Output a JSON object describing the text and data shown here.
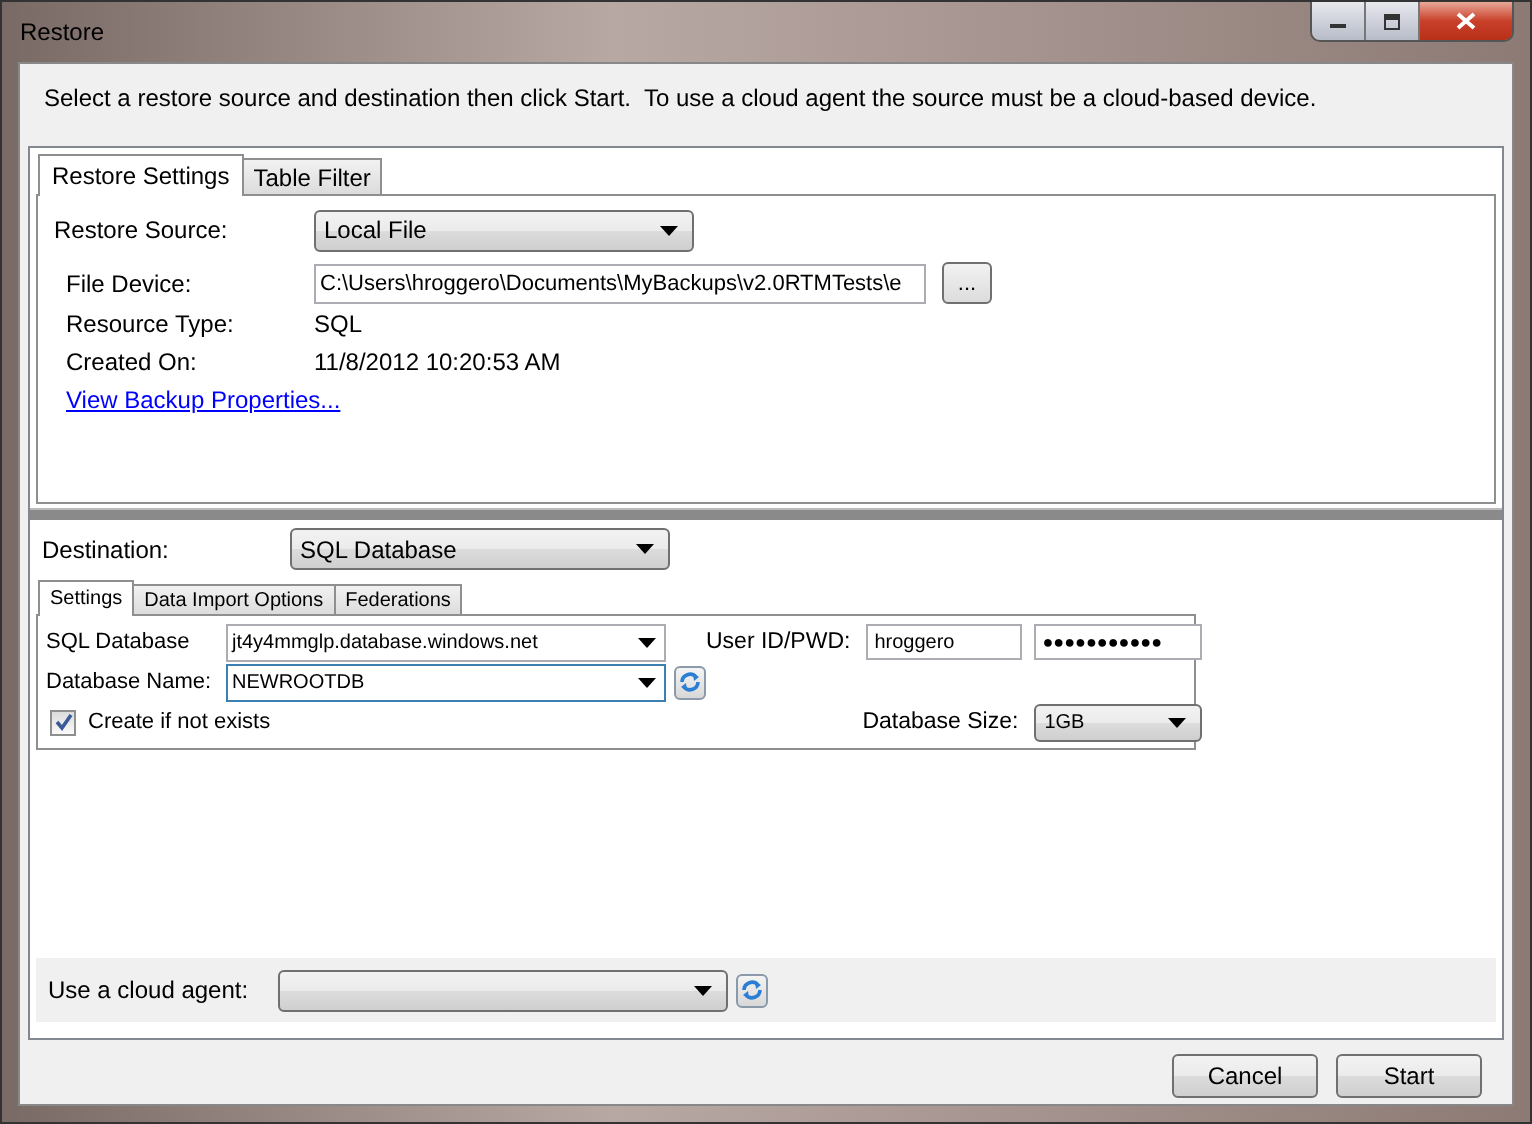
{
  "window": {
    "title": "Restore"
  },
  "instructions": "Select a restore source and destination then click Start.  To use a cloud agent the source must be a cloud-based device.",
  "source_tabs": [
    {
      "label": "Restore Settings",
      "selected": true
    },
    {
      "label": "Table Filter",
      "selected": false
    }
  ],
  "source": {
    "restore_source_label": "Restore Source:",
    "restore_source": "Local File",
    "file_device_label": "File Device:",
    "file_device": "C:\\Users\\hroggero\\Documents\\MyBackups\\v2.0RTMTests\\e",
    "browse_button": "...",
    "resource_type_label": "Resource Type:",
    "resource_type": "SQL",
    "created_on_label": "Created On:",
    "created_on": "11/8/2012 10:20:53 AM",
    "link": "View Backup Properties..."
  },
  "destination": {
    "label": "Destination:",
    "value": "SQL Database"
  },
  "settings_tabs": [
    {
      "label": "Settings",
      "selected": true
    },
    {
      "label": "Data Import Options",
      "selected": false
    },
    {
      "label": "Federations",
      "selected": false
    }
  ],
  "settings": {
    "sql_database_label": "SQL Database",
    "sql_database": "jt4y4mmglp.database.windows.net",
    "database_name_label": "Database Name:",
    "database_name": "NEWROOTDB",
    "create_if_not_exists": {
      "label": "Create if not exists",
      "checked": true
    },
    "user_label": "User ID/PWD:",
    "user_id": "hroggero",
    "password": "●●●●●●●●●●●",
    "database_size_label": "Database Size:",
    "database_size": "1GB"
  },
  "cloud_agent": {
    "label": "Use a cloud agent:"
  },
  "buttons": [
    "Cancel",
    "Start"
  ]
}
